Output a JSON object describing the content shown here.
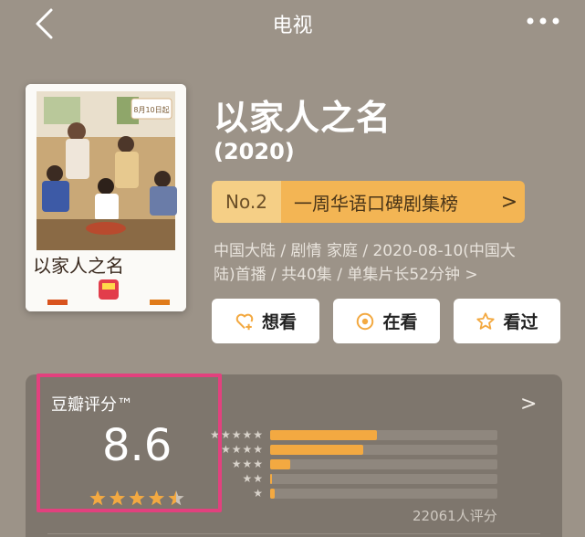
{
  "header": {
    "title": "电视"
  },
  "show": {
    "title": "以家人之名",
    "year": "(2020)",
    "poster": {
      "date_banner": "8月10日起",
      "logo_text": "以家人之名"
    },
    "rank": {
      "no": "No.2",
      "label": "一周华语口碑剧集榜",
      "chevron": ">"
    },
    "meta_line1": "中国大陆 / 剧情 家庭 / 2020-08-10(中国大",
    "meta_line2": "陆)首播 / 共40集 / 单集片长52分钟",
    "meta_chevron": ">"
  },
  "actions": [
    {
      "label": "想看",
      "icon": "heart-plus-icon"
    },
    {
      "label": "在看",
      "icon": "target-circle-icon"
    },
    {
      "label": "看过",
      "icon": "star-outline-icon"
    }
  ],
  "rating": {
    "label": "豆瓣评分™",
    "score": "8.6",
    "stars_out_of_5": 4.5,
    "chevron": ">",
    "count": "22061人评分",
    "distribution": [
      {
        "stars": 5,
        "fraction": 0.47
      },
      {
        "stars": 4,
        "fraction": 0.41
      },
      {
        "stars": 3,
        "fraction": 0.09
      },
      {
        "stars": 2,
        "fraction": 0.01
      },
      {
        "stars": 1,
        "fraction": 0.02
      }
    ]
  },
  "colors": {
    "background": "#9c9388",
    "accent": "#f3a941",
    "highlight": "#e2417e"
  }
}
